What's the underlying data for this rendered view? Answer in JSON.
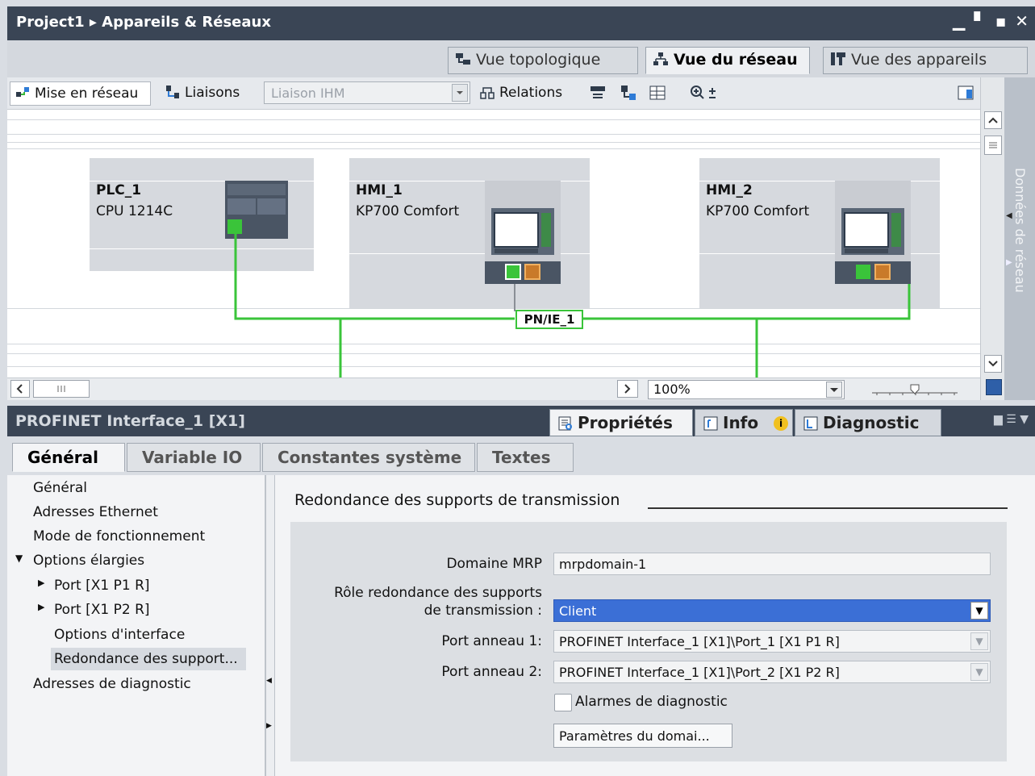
{
  "window": {
    "title": "Project1  ▸  Appareils & Réseaux",
    "controls": "▁ ▪ ▪ ✕"
  },
  "view_tabs": [
    {
      "label": "Vue topologique",
      "active": false
    },
    {
      "label": "Vue du réseau",
      "active": true
    },
    {
      "label": "Vue des appareils",
      "active": false
    }
  ],
  "toolbar": {
    "network": "Mise en réseau",
    "links": "Liaisons",
    "link_type": "Liaison IHM",
    "relations": "Relations"
  },
  "devices": [
    {
      "name": "PLC_1",
      "type": "CPU 1214C"
    },
    {
      "name": "HMI_1",
      "type": "KP700 Comfort"
    },
    {
      "name": "HMI_2",
      "type": "KP700 Comfort"
    }
  ],
  "network": {
    "subnet_label": "PN/IE_1"
  },
  "side_panel": {
    "label": "Données de réseau"
  },
  "hscroll": {
    "zoom": "100%"
  },
  "properties": {
    "title": "PROFINET Interface_1 [X1]",
    "tabs": [
      {
        "label": "Propriétés",
        "active": true
      },
      {
        "label": "Info",
        "active": false
      },
      {
        "label": "Diagnostic",
        "active": false
      }
    ],
    "subtabs": [
      {
        "label": "Général",
        "active": true
      },
      {
        "label": "Variable IO",
        "active": false
      },
      {
        "label": "Constantes système",
        "active": false
      },
      {
        "label": "Textes",
        "active": false
      }
    ],
    "nav": [
      {
        "label": "Général"
      },
      {
        "label": "Adresses Ethernet"
      },
      {
        "label": "Mode de fonctionnement"
      },
      {
        "label": "Options élargies"
      },
      {
        "label": "Port [X1 P1 R]"
      },
      {
        "label": "Port [X1 P2 R]"
      },
      {
        "label": "Options d'interface"
      },
      {
        "label": "Redondance des support..."
      },
      {
        "label": "Adresses de diagnostic"
      }
    ],
    "section": {
      "title": "Redondance des supports de transmission",
      "mrp_domain_label": "Domaine MRP",
      "mrp_domain_value": "mrpdomain-1",
      "role_label_1": "Rôle redondance des supports",
      "role_label_2": "de transmission :",
      "role_value": "Client",
      "ring1_label": "Port anneau 1:",
      "ring1_value": "PROFINET Interface_1 [X1]\\Port_1 [X1 P1 R]",
      "ring2_label": "Port anneau 2:",
      "ring2_value": "PROFINET Interface_1 [X1]\\Port_2 [X1 P2 R]",
      "diag_alarm_label": "Alarmes de diagnostic",
      "domain_params_button": "Paramètres du domai..."
    }
  }
}
